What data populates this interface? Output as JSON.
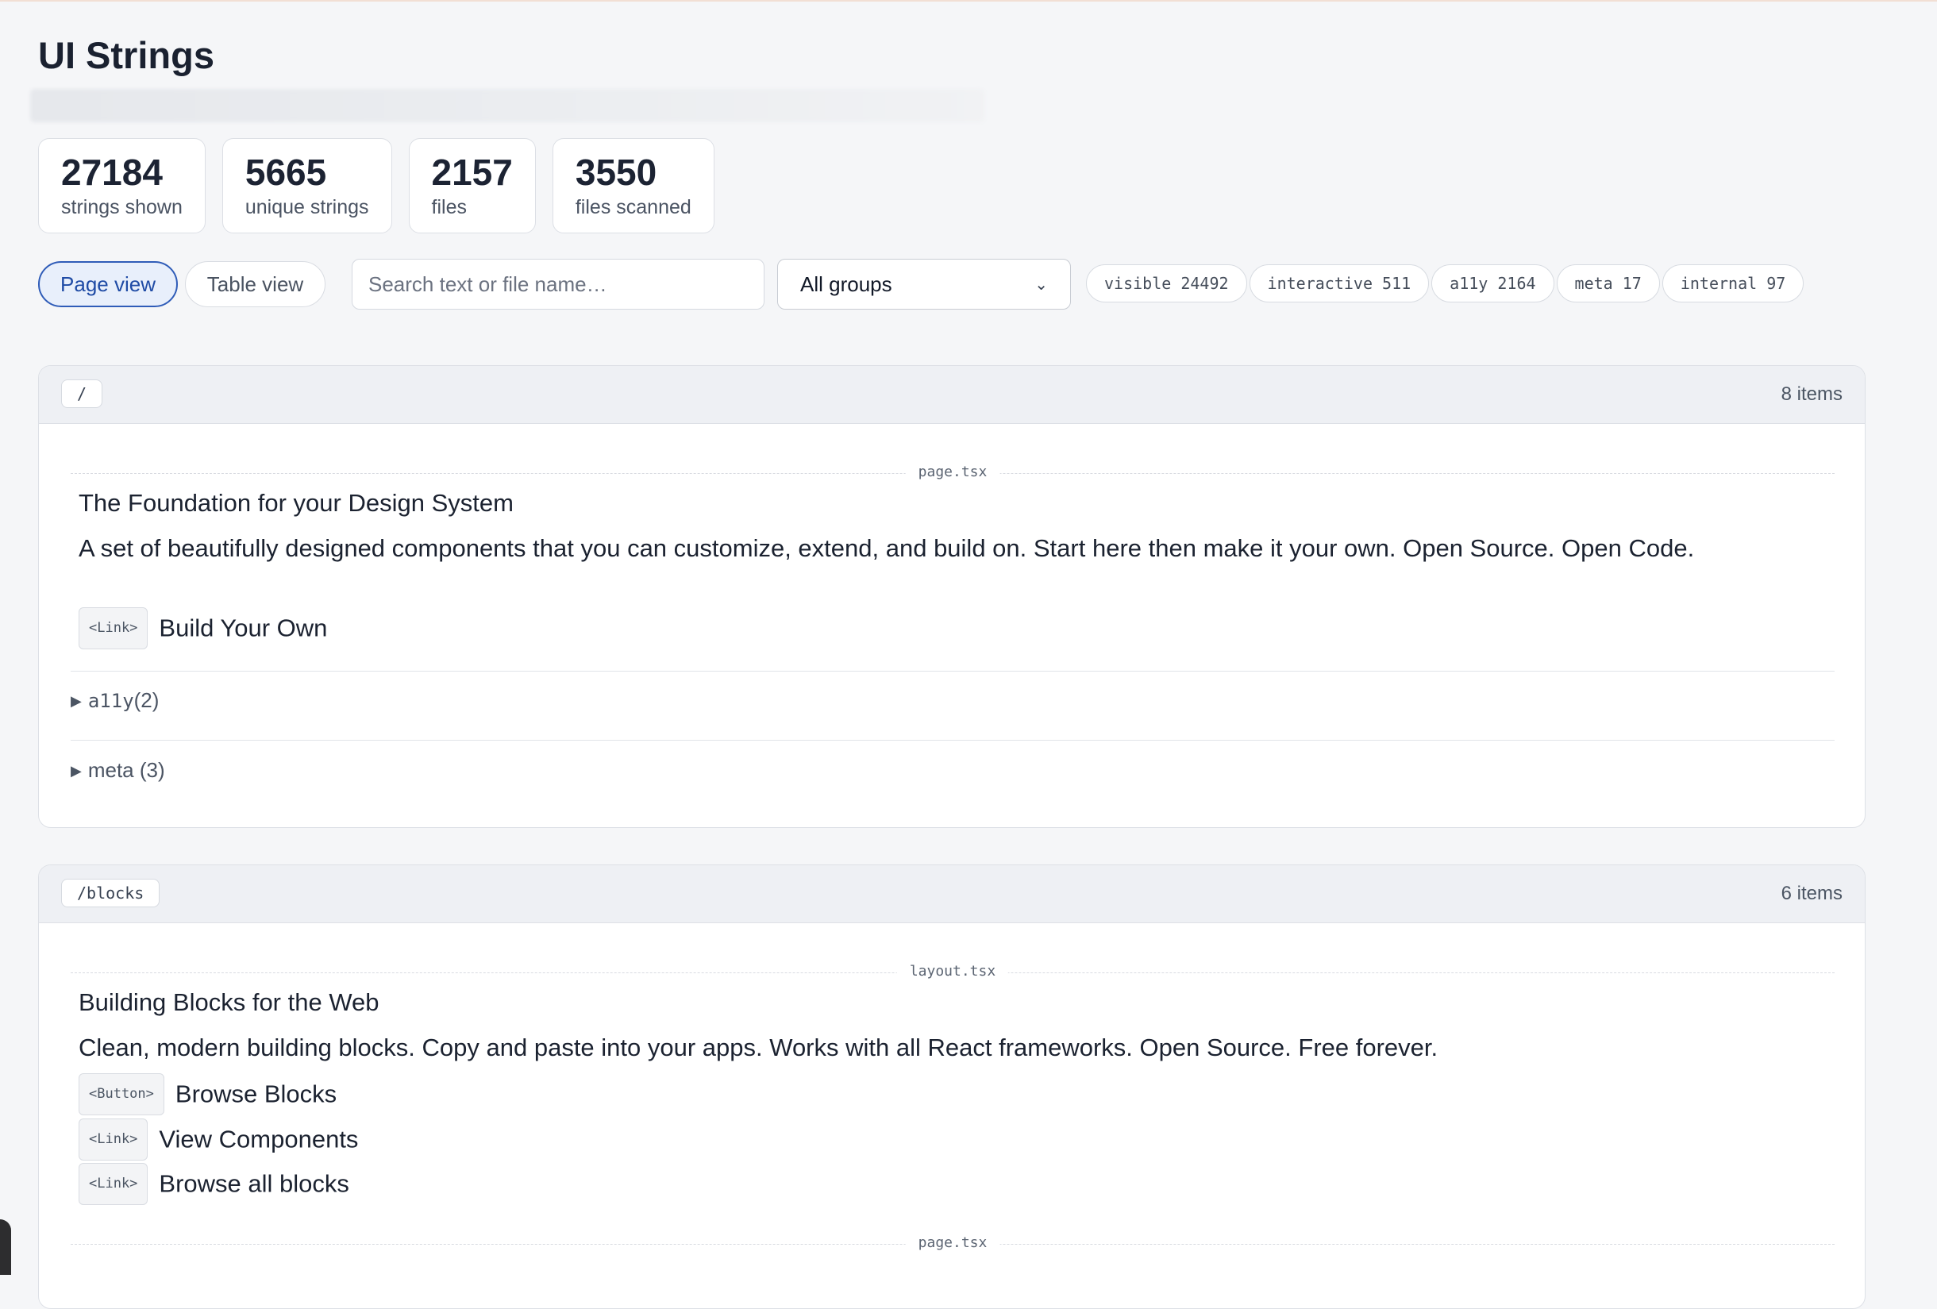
{
  "header": {
    "title": "UI Strings"
  },
  "stats": [
    {
      "value": "27184",
      "label": "strings shown"
    },
    {
      "value": "5665",
      "label": "unique strings"
    },
    {
      "value": "2157",
      "label": "files"
    },
    {
      "value": "3550",
      "label": "files scanned"
    }
  ],
  "controls": {
    "page_view": "Page view",
    "table_view": "Table view",
    "search_placeholder": "Search text or file name…",
    "group_select": "All groups"
  },
  "chips": [
    "visible 24492",
    "interactive 511",
    "a11y 2164",
    "meta 17",
    "internal 97"
  ],
  "groups": [
    {
      "route": "/",
      "count": "8 items",
      "file": "page.tsx",
      "strings": [
        {
          "text": "The Foundation for your Design System"
        },
        {
          "text": "A set of beautifully designed components that you can customize, extend, and build on. Start here then make it your own. Open Source. Open Code."
        },
        {
          "tag": "<Link>",
          "text": "Build Your Own"
        }
      ],
      "collapsed": [
        {
          "label": "a11y",
          "count": "(2)"
        },
        {
          "label": "meta",
          "count": "(3)"
        }
      ]
    },
    {
      "route": "/blocks",
      "count": "6 items",
      "file": "layout.tsx",
      "file2": "page.tsx",
      "strings": [
        {
          "text": "Building Blocks for the Web"
        },
        {
          "text": "Clean, modern building blocks. Copy and paste into your apps. Works with all React frameworks. Open Source. Free forever."
        },
        {
          "tag": "<Button>",
          "text": "Browse Blocks"
        },
        {
          "tag": "<Link>",
          "text": "View Components"
        },
        {
          "tag": "<Link>",
          "text": "Browse all blocks"
        }
      ]
    }
  ]
}
